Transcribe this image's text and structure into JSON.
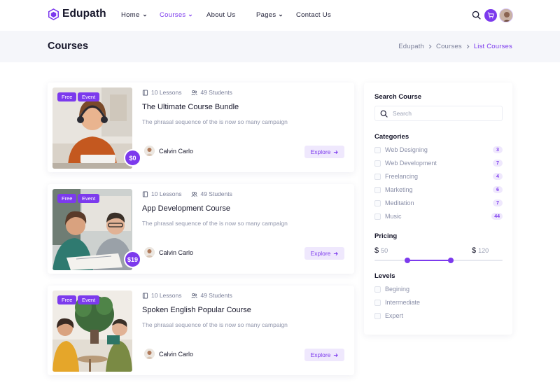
{
  "brand": {
    "name": "Edupath",
    "accent": "#7c3aed"
  },
  "nav": {
    "items": [
      {
        "label": "Home",
        "dropdown": true,
        "active": false
      },
      {
        "label": "Courses",
        "dropdown": true,
        "active": true
      },
      {
        "label": "About Us",
        "dropdown": false,
        "active": false
      },
      {
        "label": "Pages",
        "dropdown": true,
        "active": false
      },
      {
        "label": "Contact Us",
        "dropdown": false,
        "active": false
      }
    ],
    "icons": [
      "search-icon",
      "cart-icon",
      "user-avatar"
    ]
  },
  "banner": {
    "title": "Courses",
    "breadcrumb": [
      "Edupath",
      "Courses",
      "List Courses"
    ]
  },
  "courses": [
    {
      "tags": [
        "Free",
        "Event"
      ],
      "lessons": "10 Lessons",
      "students": "49 Students",
      "title": "The Ultimate Course Bundle",
      "description": "The phrasal sequence of the is now so many campaign",
      "price": "$0",
      "instructor": "Calvin Carlo",
      "button": "Explore"
    },
    {
      "tags": [
        "Free",
        "Event"
      ],
      "lessons": "10 Lessons",
      "students": "49 Students",
      "title": "App Development Course",
      "description": "The phrasal sequence of the is now so many campaign",
      "price": "$19",
      "instructor": "Calvin Carlo",
      "button": "Explore"
    },
    {
      "tags": [
        "Free",
        "Event"
      ],
      "lessons": "10 Lessons",
      "students": "49 Students",
      "title": "Spoken English Popular Course",
      "description": "The phrasal sequence of the is now so many campaign",
      "price": "",
      "instructor": "Calvin Carlo",
      "button": "Explore"
    }
  ],
  "sidebar": {
    "search": {
      "heading": "Search Course",
      "placeholder": "Search"
    },
    "categories": {
      "heading": "Categories",
      "items": [
        {
          "label": "Web Designing",
          "count": "3"
        },
        {
          "label": "Web Development",
          "count": "7"
        },
        {
          "label": "Freelancing",
          "count": "4"
        },
        {
          "label": "Marketing",
          "count": "6"
        },
        {
          "label": "Meditation",
          "count": "7"
        },
        {
          "label": "Music",
          "count": "44"
        }
      ]
    },
    "pricing": {
      "heading": "Pricing",
      "currency": "$",
      "min": "50",
      "max": "120"
    },
    "levels": {
      "heading": "Levels",
      "items": [
        "Begining",
        "Intermediate",
        "Expert"
      ]
    }
  }
}
